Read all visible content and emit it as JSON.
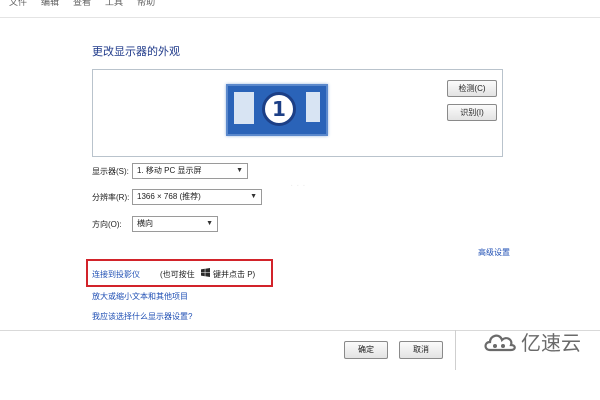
{
  "menubar": {
    "items": [
      "文件",
      "编辑",
      "查看",
      "工具",
      "帮助"
    ]
  },
  "page": {
    "title": "更改显示器的外观"
  },
  "preview": {
    "monitor_number": "1"
  },
  "buttons": {
    "detect": "检测(C)",
    "identify": "识别(I)",
    "ok": "确定",
    "cancel": "取消"
  },
  "fields": {
    "display": {
      "label": "显示器(S):",
      "value": "1. 移动 PC 显示屏"
    },
    "resolution": {
      "label": "分辨率(R):",
      "value": "1366 × 768 (推荐)"
    },
    "orientation": {
      "label": "方向(O):",
      "value": "横向"
    }
  },
  "links": {
    "advanced": "高级设置",
    "projector": "连接到投影仪",
    "text_size": "放大或缩小文本和其他项目",
    "which_settings": "我应该选择什么显示器设置?"
  },
  "hint": {
    "part1": "(也可按住",
    "part2": "键并点击 P)"
  },
  "icons": {
    "windows": "windows-key-icon",
    "brand": "cloud-logo-icon"
  },
  "brand": {
    "text": "亿速云"
  },
  "colors": {
    "link": "#1f4fb4",
    "highlight_box": "#d2232a",
    "monitor": "#2a63b8"
  }
}
